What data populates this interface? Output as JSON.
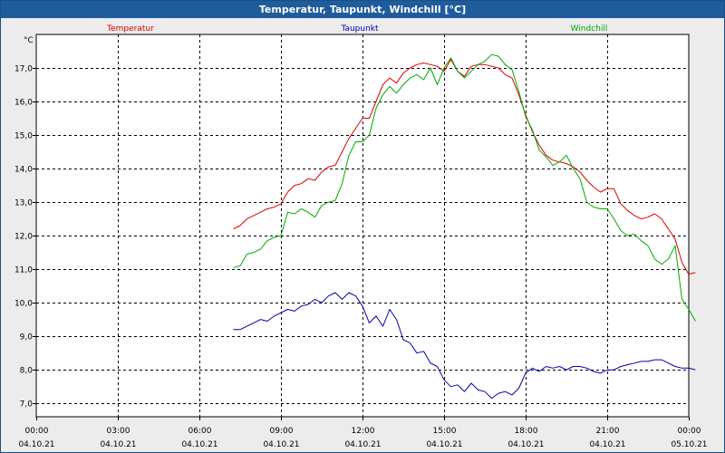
{
  "window": {
    "title": "Temperatur, Taupunkt, Windchill [°C]"
  },
  "chart_data": {
    "type": "line",
    "title": "Temperatur, Taupunkt, Windchill [°C]",
    "ylabel": "°C",
    "xlabel": "",
    "ylim": [
      6.6,
      18.0
    ],
    "xlim": [
      0,
      24
    ],
    "grid": true,
    "legend_placement": "top",
    "y_ticks": [
      "7,0",
      "8,0",
      "9,0",
      "10,0",
      "11,0",
      "12,0",
      "13,0",
      "14,0",
      "15,0",
      "16,0",
      "17,0"
    ],
    "x_ticks": [
      {
        "time": "00:00",
        "date": "04.10.21"
      },
      {
        "time": "03:00",
        "date": "04.10.21"
      },
      {
        "time": "06:00",
        "date": "04.10.21"
      },
      {
        "time": "09:00",
        "date": "04.10.21"
      },
      {
        "time": "12:00",
        "date": "04.10.21"
      },
      {
        "time": "15:00",
        "date": "04.10.21"
      },
      {
        "time": "18:00",
        "date": "04.10.21"
      },
      {
        "time": "21:00",
        "date": "04.10.21"
      },
      {
        "time": "00:00",
        "date": "05.10.21"
      }
    ],
    "series": [
      {
        "name": "Temperatur",
        "color": "#dd0000",
        "points": [
          [
            7.25,
            12.2
          ],
          [
            7.5,
            12.3
          ],
          [
            7.75,
            12.5
          ],
          [
            8.0,
            12.6
          ],
          [
            8.25,
            12.7
          ],
          [
            8.5,
            12.8
          ],
          [
            8.75,
            12.85
          ],
          [
            9.0,
            12.95
          ],
          [
            9.25,
            13.3
          ],
          [
            9.5,
            13.5
          ],
          [
            9.75,
            13.55
          ],
          [
            10.0,
            13.7
          ],
          [
            10.25,
            13.65
          ],
          [
            10.5,
            13.9
          ],
          [
            10.75,
            14.05
          ],
          [
            11.0,
            14.1
          ],
          [
            11.25,
            14.5
          ],
          [
            11.5,
            14.9
          ],
          [
            11.75,
            15.2
          ],
          [
            12.0,
            15.5
          ],
          [
            12.25,
            15.5
          ],
          [
            12.5,
            16.0
          ],
          [
            12.75,
            16.5
          ],
          [
            13.0,
            16.7
          ],
          [
            13.25,
            16.55
          ],
          [
            13.5,
            16.85
          ],
          [
            13.75,
            17.0
          ],
          [
            14.0,
            17.1
          ],
          [
            14.25,
            17.15
          ],
          [
            14.5,
            17.1
          ],
          [
            14.75,
            17.05
          ],
          [
            15.0,
            16.9
          ],
          [
            15.25,
            17.25
          ],
          [
            15.5,
            16.9
          ],
          [
            15.75,
            16.75
          ],
          [
            16.0,
            17.05
          ],
          [
            16.25,
            17.1
          ],
          [
            16.5,
            17.1
          ],
          [
            16.75,
            17.05
          ],
          [
            17.0,
            17.0
          ],
          [
            17.25,
            16.8
          ],
          [
            17.5,
            16.7
          ],
          [
            17.75,
            16.2
          ],
          [
            18.0,
            15.6
          ],
          [
            18.25,
            15.1
          ],
          [
            18.5,
            14.7
          ],
          [
            18.75,
            14.4
          ],
          [
            19.0,
            14.25
          ],
          [
            19.25,
            14.2
          ],
          [
            19.5,
            14.15
          ],
          [
            19.75,
            14.05
          ],
          [
            20.0,
            13.9
          ],
          [
            20.25,
            13.65
          ],
          [
            20.5,
            13.45
          ],
          [
            20.75,
            13.3
          ],
          [
            21.0,
            13.4
          ],
          [
            21.25,
            13.4
          ],
          [
            21.5,
            12.95
          ],
          [
            21.75,
            12.75
          ],
          [
            22.0,
            12.6
          ],
          [
            22.25,
            12.5
          ],
          [
            22.5,
            12.55
          ],
          [
            22.75,
            12.65
          ],
          [
            23.0,
            12.5
          ],
          [
            23.25,
            12.2
          ],
          [
            23.5,
            11.9
          ],
          [
            23.75,
            11.2
          ],
          [
            24.0,
            10.85
          ],
          [
            24.25,
            10.9
          ]
        ]
      },
      {
        "name": "Taupunkt",
        "color": "#0000aa",
        "points": [
          [
            7.25,
            9.2
          ],
          [
            7.5,
            9.2
          ],
          [
            7.75,
            9.3
          ],
          [
            8.0,
            9.4
          ],
          [
            8.25,
            9.5
          ],
          [
            8.5,
            9.45
          ],
          [
            8.75,
            9.6
          ],
          [
            9.0,
            9.7
          ],
          [
            9.25,
            9.8
          ],
          [
            9.5,
            9.75
          ],
          [
            9.75,
            9.9
          ],
          [
            10.0,
            9.95
          ],
          [
            10.25,
            10.1
          ],
          [
            10.5,
            10.0
          ],
          [
            10.75,
            10.2
          ],
          [
            11.0,
            10.3
          ],
          [
            11.25,
            10.1
          ],
          [
            11.5,
            10.3
          ],
          [
            11.75,
            10.2
          ],
          [
            12.0,
            9.9
          ],
          [
            12.25,
            9.4
          ],
          [
            12.5,
            9.6
          ],
          [
            12.75,
            9.3
          ],
          [
            13.0,
            9.8
          ],
          [
            13.25,
            9.5
          ],
          [
            13.5,
            8.9
          ],
          [
            13.75,
            8.8
          ],
          [
            14.0,
            8.5
          ],
          [
            14.25,
            8.55
          ],
          [
            14.5,
            8.2
          ],
          [
            14.75,
            8.1
          ],
          [
            15.0,
            7.7
          ],
          [
            15.25,
            7.5
          ],
          [
            15.5,
            7.55
          ],
          [
            15.75,
            7.35
          ],
          [
            16.0,
            7.6
          ],
          [
            16.25,
            7.4
          ],
          [
            16.5,
            7.35
          ],
          [
            16.75,
            7.15
          ],
          [
            17.0,
            7.3
          ],
          [
            17.25,
            7.35
          ],
          [
            17.5,
            7.25
          ],
          [
            17.75,
            7.45
          ],
          [
            18.0,
            7.9
          ],
          [
            18.25,
            8.05
          ],
          [
            18.5,
            7.95
          ],
          [
            18.75,
            8.1
          ],
          [
            19.0,
            8.05
          ],
          [
            19.25,
            8.1
          ],
          [
            19.5,
            8.0
          ],
          [
            19.75,
            8.1
          ],
          [
            20.0,
            8.1
          ],
          [
            20.25,
            8.05
          ],
          [
            20.5,
            7.95
          ],
          [
            20.75,
            7.9
          ],
          [
            21.0,
            8.0
          ],
          [
            21.25,
            8.0
          ],
          [
            21.5,
            8.1
          ],
          [
            21.75,
            8.15
          ],
          [
            22.0,
            8.2
          ],
          [
            22.25,
            8.25
          ],
          [
            22.5,
            8.25
          ],
          [
            22.75,
            8.3
          ],
          [
            23.0,
            8.3
          ],
          [
            23.25,
            8.2
          ],
          [
            23.5,
            8.1
          ],
          [
            23.75,
            8.05
          ],
          [
            24.0,
            8.05
          ],
          [
            24.25,
            8.0
          ]
        ]
      },
      {
        "name": "Windchill",
        "color": "#00aa00",
        "points": [
          [
            7.25,
            11.05
          ],
          [
            7.5,
            11.1
          ],
          [
            7.75,
            11.45
          ],
          [
            8.0,
            11.5
          ],
          [
            8.25,
            11.6
          ],
          [
            8.5,
            11.85
          ],
          [
            8.75,
            11.95
          ],
          [
            9.0,
            12.0
          ],
          [
            9.25,
            12.7
          ],
          [
            9.5,
            12.65
          ],
          [
            9.75,
            12.8
          ],
          [
            10.0,
            12.7
          ],
          [
            10.25,
            12.55
          ],
          [
            10.5,
            12.9
          ],
          [
            10.75,
            13.0
          ],
          [
            11.0,
            13.05
          ],
          [
            11.25,
            13.55
          ],
          [
            11.5,
            14.4
          ],
          [
            11.75,
            14.8
          ],
          [
            12.0,
            14.8
          ],
          [
            12.25,
            15.0
          ],
          [
            12.5,
            15.8
          ],
          [
            12.75,
            16.2
          ],
          [
            13.0,
            16.45
          ],
          [
            13.25,
            16.25
          ],
          [
            13.5,
            16.5
          ],
          [
            13.75,
            16.7
          ],
          [
            14.0,
            16.8
          ],
          [
            14.25,
            16.65
          ],
          [
            14.5,
            17.0
          ],
          [
            14.75,
            16.5
          ],
          [
            15.0,
            17.0
          ],
          [
            15.25,
            17.3
          ],
          [
            15.5,
            16.9
          ],
          [
            15.75,
            16.7
          ],
          [
            16.0,
            16.9
          ],
          [
            16.25,
            17.1
          ],
          [
            16.5,
            17.2
          ],
          [
            16.75,
            17.4
          ],
          [
            17.0,
            17.35
          ],
          [
            17.25,
            17.1
          ],
          [
            17.5,
            16.95
          ],
          [
            17.75,
            16.3
          ],
          [
            18.0,
            15.55
          ],
          [
            18.25,
            15.15
          ],
          [
            18.5,
            14.55
          ],
          [
            18.75,
            14.35
          ],
          [
            19.0,
            14.1
          ],
          [
            19.25,
            14.2
          ],
          [
            19.5,
            14.4
          ],
          [
            19.75,
            14.0
          ],
          [
            20.0,
            13.7
          ],
          [
            20.25,
            13.0
          ],
          [
            20.5,
            12.85
          ],
          [
            20.75,
            12.8
          ],
          [
            21.0,
            12.8
          ],
          [
            21.25,
            12.5
          ],
          [
            21.5,
            12.15
          ],
          [
            21.75,
            12.0
          ],
          [
            22.0,
            12.05
          ],
          [
            22.25,
            11.85
          ],
          [
            22.5,
            11.7
          ],
          [
            22.75,
            11.3
          ],
          [
            23.0,
            11.15
          ],
          [
            23.25,
            11.3
          ],
          [
            23.5,
            11.7
          ],
          [
            23.75,
            10.1
          ],
          [
            24.0,
            9.8
          ],
          [
            24.25,
            9.45
          ]
        ]
      }
    ]
  }
}
